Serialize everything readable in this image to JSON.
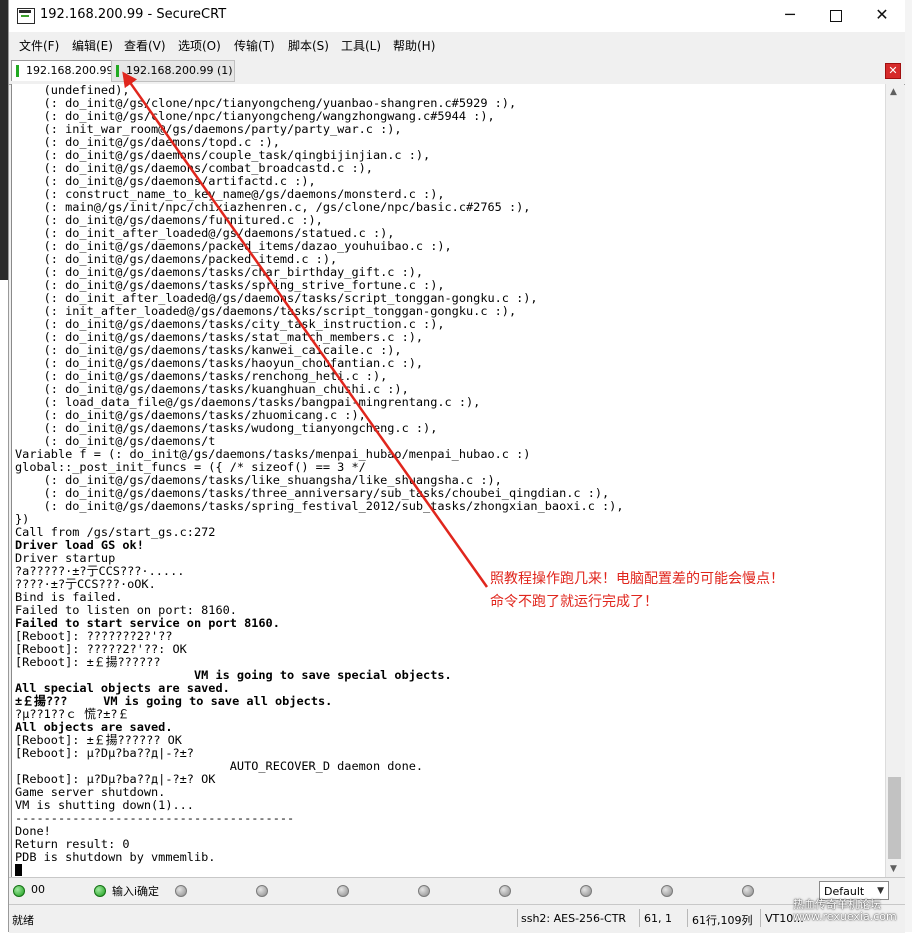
{
  "window": {
    "title": "192.168.200.99 - SecureCRT",
    "controls": {
      "minimize": "─",
      "close": "✕"
    }
  },
  "menu": [
    {
      "label": "文件(F)"
    },
    {
      "label": "编辑(E)"
    },
    {
      "label": "查看(V)"
    },
    {
      "label": "选项(O)"
    },
    {
      "label": "传输(T)"
    },
    {
      "label": "脚本(S)"
    },
    {
      "label": "工具(L)"
    },
    {
      "label": "帮助(H)"
    }
  ],
  "tabs": [
    {
      "label": "192.168.200.99",
      "active": true
    },
    {
      "label": "192.168.200.99 (1)",
      "active": false
    }
  ],
  "terminal": {
    "lines": [
      {
        "text": "    (undefined),"
      },
      {
        "text": "    (: do_init@/gs/clone/npc/tianyongcheng/yuanbao-shangren.c#5929 :),"
      },
      {
        "text": "    (: do_init@/gs/clone/npc/tianyongcheng/wangzhongwang.c#5944 :),"
      },
      {
        "text": "    (: init_war_room@/gs/daemons/party/party_war.c :),"
      },
      {
        "text": "    (: do_init@/gs/daemons/topd.c :),"
      },
      {
        "text": "    (: do_init@/gs/daemons/couple_task/qingbijinjian.c :),"
      },
      {
        "text": "    (: do_init@/gs/daemons/combat_broadcastd.c :),"
      },
      {
        "text": "    (: do_init@/gs/daemons/artifactd.c :),"
      },
      {
        "text": "    (: construct_name_to_key_name@/gs/daemons/monsterd.c :),"
      },
      {
        "text": "    (: main@/gs/init/npc/chixiazhenren.c, /gs/clone/npc/basic.c#2765 :),"
      },
      {
        "text": "    (: do_init@/gs/daemons/furnitured.c :),"
      },
      {
        "text": "    (: do_init_after_loaded@/gs/daemons/statued.c :),"
      },
      {
        "text": "    (: do_init@/gs/daemons/packed_items/dazao_youhuibao.c :),"
      },
      {
        "text": "    (: do_init@/gs/daemons/packed_itemd.c :),"
      },
      {
        "text": "    (: do_init@/gs/daemons/tasks/char_birthday_gift.c :),"
      },
      {
        "text": "    (: do_init@/gs/daemons/tasks/spring_strive_fortune.c :),"
      },
      {
        "text": "    (: do_init_after_loaded@/gs/daemons/tasks/script_tonggan-gongku.c :),"
      },
      {
        "text": "    (: init_after_loaded@/gs/daemons/tasks/script_tonggan-gongku.c :),"
      },
      {
        "text": "    (: do_init@/gs/daemons/tasks/city_task_instruction.c :),"
      },
      {
        "text": "    (: do_init@/gs/daemons/tasks/stat_match_members.c :),"
      },
      {
        "text": "    (: do_init@/gs/daemons/tasks/kanwei_caicaile.c :),"
      },
      {
        "text": "    (: do_init@/gs/daemons/tasks/haoyun_choufantian.c :),"
      },
      {
        "text": "    (: do_init@/gs/daemons/tasks/renchong_heti.c :),"
      },
      {
        "text": "    (: do_init@/gs/daemons/tasks/kuanghuan_chushi.c :),"
      },
      {
        "text": "    (: load_data_file@/gs/daemons/tasks/bangpai-mingrentang.c :),"
      },
      {
        "text": "    (: do_init@/gs/daemons/tasks/zhuomicang.c :),"
      },
      {
        "text": "    (: do_init@/gs/daemons/tasks/wudong_tianyongcheng.c :),"
      },
      {
        "text": "    (: do_init@/gs/daemons/t"
      },
      {
        "text": "Variable f = (: do_init@/gs/daemons/tasks/menpai_hubao/menpai_hubao.c :)"
      },
      {
        "text": "global::_post_init_funcs = ({ /* sizeof() == 3 */"
      },
      {
        "text": "    (: do_init@/gs/daemons/tasks/like_shuangsha/like_shuangsha.c :),"
      },
      {
        "text": "    (: do_init@/gs/daemons/tasks/three_anniversary/sub_tasks/choubei_qingdian.c :),"
      },
      {
        "text": "    (: do_init@/gs/daemons/tasks/spring_festival_2012/sub_tasks/zhongxian_baoxi.c :),"
      },
      {
        "text": "})"
      },
      {
        "text": "Call from /gs/start_gs.c:272"
      },
      {
        "text": "Driver load GS ok!",
        "bold": true
      },
      {
        "text": "Driver startup"
      },
      {
        "text": "?a?????·±?亍CCS???·....."
      },
      {
        "text": "????·±?亍CCS???·oOK."
      },
      {
        "text": "Bind is failed."
      },
      {
        "text": "Failed to listen on port: 8160."
      },
      {
        "text": "Failed to start service on port 8160.",
        "bold": true
      },
      {
        "text": "[Reboot]: ???????2?'??"
      },
      {
        "text": "[Reboot]: ?????2?'??: OK"
      },
      {
        "text": "[Reboot]: ±￡揚??????"
      },
      {
        "text": "                         VM is going to save special objects.",
        "bold": true
      },
      {
        "text": "All special objects are saved.",
        "bold": true
      },
      {
        "text": "±￡揚???     VM is going to save all objects.",
        "bold": true
      },
      {
        "text": "?μ??1??ｃ 慌?±?￡"
      },
      {
        "text": "All objects are saved.",
        "bold": true
      },
      {
        "text": "[Reboot]: ±￡揚?????? OK"
      },
      {
        "text": "[Reboot]: μ?Dμ?ba??д|-?±?"
      },
      {
        "text": "                              AUTO_RECOVER_D daemon done."
      },
      {
        "text": "[Reboot]: μ?Dμ?ba??д|-?±? OK"
      },
      {
        "text": "Game server shutdown."
      },
      {
        "text": "VM is shutting down(1)..."
      },
      {
        "text": "---------------------------------------"
      },
      {
        "text": "Done!"
      },
      {
        "text": "Return result: 0"
      },
      {
        "text": "PDB is shutdown by vmmemlib."
      },
      {
        "text": "",
        "cursor": true
      }
    ]
  },
  "annotation": {
    "line1": "照教程操作跑几来！电脑配置差的可能会慢点！",
    "line2": "命令不跑了就运行完成了！",
    "color": "#e0261d"
  },
  "button_bar": {
    "items": [
      {
        "label": "00"
      },
      {
        "label": "输入i确定"
      }
    ],
    "session": "Default"
  },
  "statusbar": {
    "ready": "就绪",
    "cipher": "ssh2: AES-256-CTR",
    "cursor_pos": "61,  1",
    "size": "61行,109列",
    "terminal_type": "VT10..."
  },
  "watermark": {
    "line1": "热血传奇单机论坛",
    "line2": "www.rexuexia.com"
  }
}
